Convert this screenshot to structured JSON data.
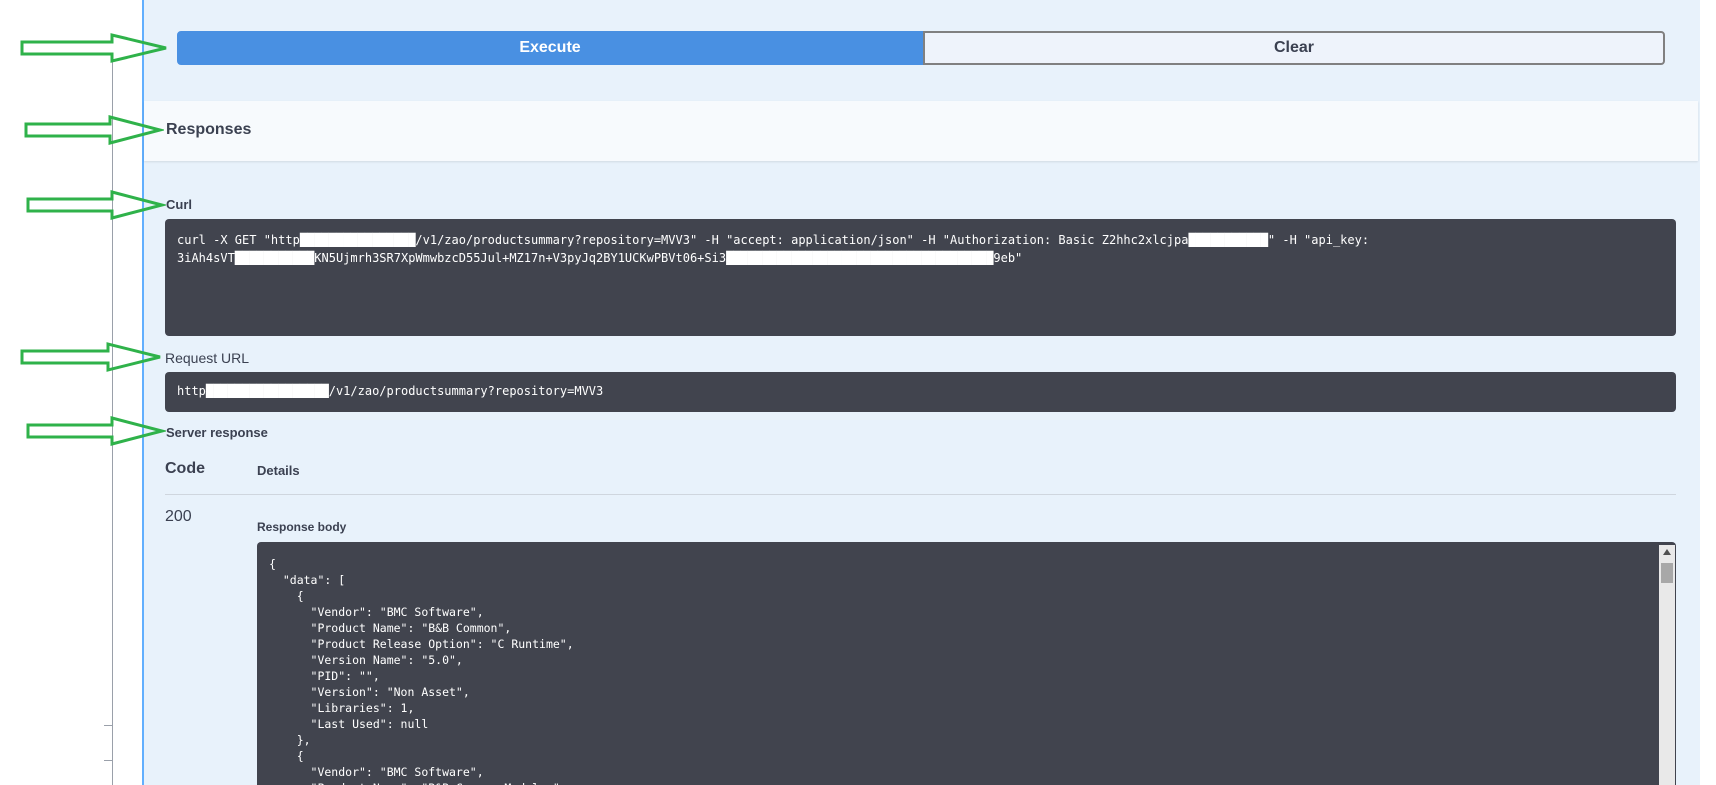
{
  "buttons": {
    "execute": "Execute",
    "clear": "Clear"
  },
  "responses": {
    "title": "Responses"
  },
  "curl": {
    "label": "Curl",
    "line1": "curl -X GET \"http████████████████/v1/zao/productsummary?repository=MVV3\" -H \"accept: application/json\" -H \"Authorization: Basic Z2hhc2xlcjpa███████████\" -H \"api_key:",
    "line2": "3iAh4sVT███████████KN5Ujmrh3SR7XpWmwbzcD55Jul+MZ17n+V3pyJq2BY1UCKwPBVt06+Si3█████████████████████████████████████9eb\""
  },
  "request_url": {
    "label": "Request URL",
    "value": "http█████████████████/v1/zao/productsummary?repository=MVV3"
  },
  "server_response": {
    "label": "Server response",
    "code_header": "Code",
    "details_header": "Details",
    "code": "200",
    "body_label": "Response body",
    "body": "{\n  \"data\": [\n    {\n      \"Vendor\": \"BMC Software\",\n      \"Product Name\": \"B&B Common\",\n      \"Product Release Option\": \"C Runtime\",\n      \"Version Name\": \"5.0\",\n      \"PID\": \"\",\n      \"Version\": \"Non Asset\",\n      \"Libraries\": 1,\n      \"Last Used\": null\n    },\n    {\n      \"Vendor\": \"BMC Software\",\n      \"Product Name\": \"B&B Common Modules\","
  },
  "colors": {
    "accent": "#4990e2",
    "code_bg": "#41444e",
    "arrow": "#2fb24a"
  }
}
